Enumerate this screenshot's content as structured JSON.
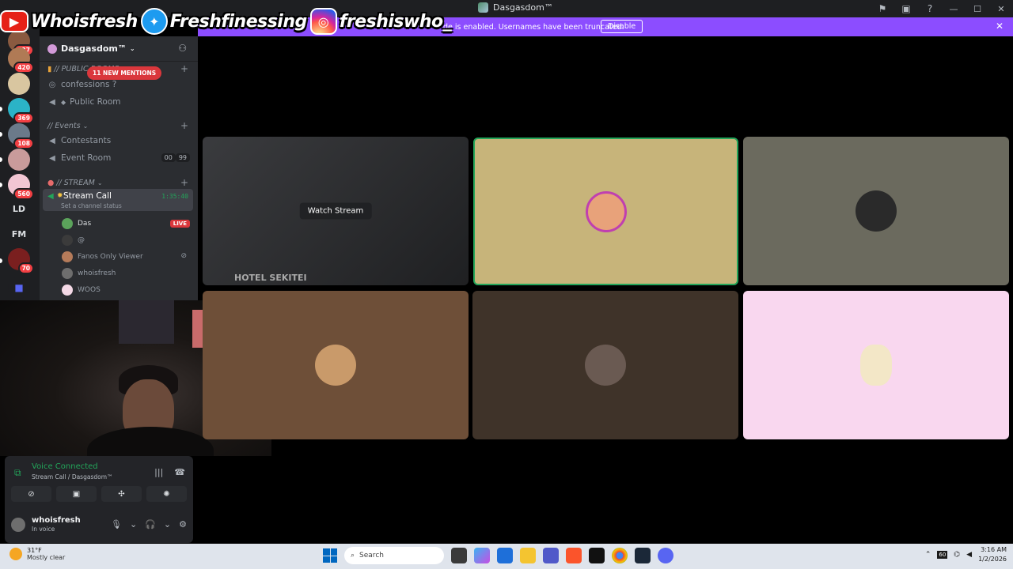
{
  "window": {
    "title": "Dasgasdom™"
  },
  "overlay": {
    "youtube": "Whoisfresh",
    "twitter": "Freshfinessing",
    "instagram": "freshiswho_"
  },
  "notice": {
    "text": "de is enabled. Usernames have been truncated.",
    "button": "Disable"
  },
  "rail": {
    "badges": [
      "537",
      "420",
      "369",
      "108",
      "560",
      "70"
    ],
    "text_servers": [
      "LD",
      "FM"
    ]
  },
  "sidebar": {
    "server_name": "Dasgasdom™",
    "mentions": "11 NEW MENTIONS",
    "categories": [
      "// PUBLIC ROOMS",
      "// Events",
      "// STREAM"
    ],
    "public_channels": [
      "confessions ?",
      "Public Room"
    ],
    "event_channels": [
      "Contestants",
      "Event Room"
    ],
    "event_counts": [
      "00",
      "99"
    ],
    "active_channel": {
      "name": "Stream Call",
      "status": "Set a channel status",
      "timer": "1:35:40"
    },
    "voice_users": [
      "Das",
      "@",
      "Fanos Only Viewer",
      "whoisfresh",
      "WOOS"
    ],
    "live_label": "LIVE"
  },
  "voice_panel": {
    "status": "Voice Connected",
    "channel": "Stream Call / Dasgasdom™",
    "user": "whoisfresh",
    "user_status": "In voice"
  },
  "grid": {
    "watch_label": "Watch Stream",
    "stream_caption": "HOTEL SEKITEI",
    "tile_colors": [
      "#2b2c2e",
      "#c7b47a",
      "#6b6a5e",
      "#6e4f38",
      "#3f3329",
      "#f9d7ef"
    ]
  },
  "taskbar": {
    "temp": "31°F",
    "weather": "Mostly clear",
    "search": "Search",
    "time": "3:16 AM",
    "date": "1/2/2026",
    "tray_num": "60"
  }
}
